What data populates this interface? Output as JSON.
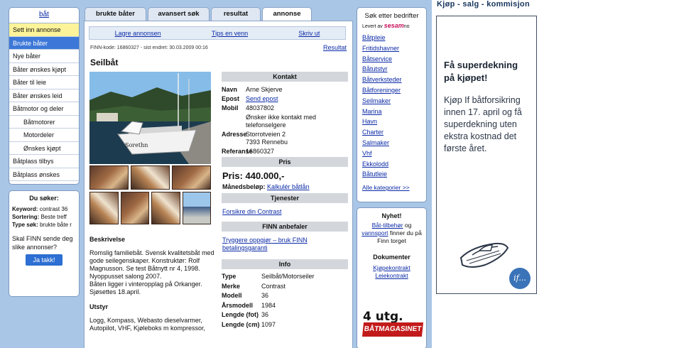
{
  "left_nav": {
    "header": "båt",
    "items": [
      {
        "label": "Sett inn annonse",
        "state": "yellow"
      },
      {
        "label": "Brukte båter",
        "state": "selected"
      },
      {
        "label": "Nye båter",
        "state": ""
      },
      {
        "label": "Båter ønskes kjøpt",
        "state": ""
      },
      {
        "label": "Båter til leie",
        "state": ""
      },
      {
        "label": "Båter ønskes leid",
        "state": ""
      },
      {
        "label": "Båtmotor og deler",
        "state": ""
      },
      {
        "label": "Båtmotorer",
        "state": "sub"
      },
      {
        "label": "Motordeler",
        "state": "sub"
      },
      {
        "label": "Ønskes kjøpt",
        "state": "sub"
      },
      {
        "label": "Båtplass tilbys",
        "state": ""
      },
      {
        "label": "Båtplass ønskes",
        "state": ""
      }
    ]
  },
  "search_info": {
    "title": "Du søker:",
    "keyword_label": "Keyword:",
    "keyword_value": "contrast 36",
    "sort_label": "Sortering:",
    "sort_value": "Beste treff",
    "type_label": "Type søk:",
    "type_value": "brukte båte r",
    "question": "Skal FINN sende deg slike annonser?",
    "button": "Ja takk!"
  },
  "tabs": [
    "brukte båter",
    "avansert søk",
    "resultat",
    "annonse"
  ],
  "actions": [
    "Lagre annonsen",
    "Tips en venn",
    "Skriv ut"
  ],
  "finn_code": "FINN-kode: 16860327 - sist endret: 30.03.2009 00:16",
  "resultat_link": "Resultat",
  "ad_title": "Seilbåt",
  "contact": {
    "header": "Kontakt",
    "name_label": "Navn",
    "name": "Arne Skjerve",
    "email_label": "Epost",
    "email": "Send epost",
    "mobile_label": "Mobil",
    "mobile": "48037802",
    "no_contact": "Ønsker ikke kontakt med telefonselgere",
    "address_label": "Adresse",
    "address1": "Storrotveien 2",
    "address2": "7393 Rennebu",
    "ref_label": "Referanse",
    "ref": "16860327"
  },
  "price": {
    "header": "Pris",
    "value": "Pris: 440.000,-",
    "monthly_label": "Månedsbeløp:",
    "monthly_link": "Kalkulér båtlån"
  },
  "services": {
    "header": "Tjenester",
    "link": "Forsikre din Contrast"
  },
  "recommends": {
    "header": "FINN anbefaler",
    "link": "Tryggere oppgjør – bruk FINN betalingsgaranti"
  },
  "info": {
    "header": "Info",
    "rows": [
      {
        "k": "Type",
        "v": "Seilbåt/Motorseiler"
      },
      {
        "k": "Merke",
        "v": "Contrast"
      },
      {
        "k": "Modell",
        "v": "36"
      },
      {
        "k": "Årsmodell",
        "v": "1984"
      },
      {
        "k": "Lengde (fot)",
        "v": "36"
      },
      {
        "k": "Lengde (cm)",
        "v": "1097"
      }
    ]
  },
  "description": {
    "header": "Beskrivelse",
    "text1": "Romslig familiebåt. Svensk kvalitetsbåt med gode seilegenskaper. Konstruktør: Rolf Magnusson. Se test Båtnytt nr 4, 1998.",
    "text2": "Nyoppusset salong 2007.",
    "text3": "Båten ligger i vinteropplag på Orkanger. Sjøsettes 18.april.",
    "equip_header": "Utstyr",
    "equip_text": "Logg, Kompass, Webasto dieselvarmer, Autopilot, VHF, Kjøleboks m kompressor,"
  },
  "photo": {
    "boat_name": "Sorethn"
  },
  "companies": {
    "title": "Søk etter bedrifter",
    "delivered_by": "Levert av",
    "brand": "sesam",
    "brand_suffix": "no",
    "links": [
      "Båtpleie",
      "Fritidshavner",
      "Båtservice",
      "Båtutstyr",
      "Båtverksteder",
      "Båtforeninger",
      "Seilmaker",
      "Marina",
      "Havn",
      "Charter",
      "Salmaker",
      "Vhf",
      "Ekkolodd",
      "Båtutleie"
    ],
    "all_link": "Alle kategorier >>"
  },
  "news": {
    "header": "Nyhet!",
    "link1": "Båt-tilbehør",
    "t1": "og",
    "link2": "vannsport",
    "t2": "finner du på Finn torget",
    "docs_header": "Dokumenter",
    "doc1": "Kjøpekontrakt",
    "doc2": "Leiekontrakt",
    "mag_issue": "4 utg.",
    "mag_name": "BÅTMAGASINET"
  },
  "banner": {
    "top_text": "Kjøp - salg - kommisjon",
    "headline": "Få superdekning på kjøpet!",
    "body": "Kjøp If båtforsikring innen 17. april og få superdekning uten ekstra kostnad det første året.",
    "logo": "if..."
  }
}
